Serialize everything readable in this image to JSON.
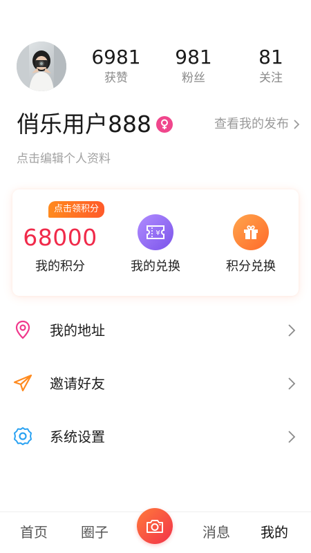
{
  "profile": {
    "username": "俏乐用户888",
    "edit_profile_text": "点击编辑个人资料",
    "view_posts_text": "查看我的发布",
    "stats": [
      {
        "value": "6981",
        "label": "获赞"
      },
      {
        "value": "981",
        "label": "粉丝"
      },
      {
        "value": "81",
        "label": "关注"
      }
    ]
  },
  "points_card": {
    "claim_badge": "点击领积分",
    "points_value": "68000",
    "points_label": "我的积分",
    "redemptions_label": "我的兑换",
    "exchange_label": "积分兑换"
  },
  "menu": [
    {
      "label": "我的地址",
      "icon": "location-pin-icon",
      "color": "#f0388c"
    },
    {
      "label": "邀请好友",
      "icon": "paper-plane-icon",
      "color": "#ff8a1e"
    },
    {
      "label": "系统设置",
      "icon": "gear-icon",
      "color": "#2aa2f2"
    }
  ],
  "tabbar": {
    "home": "首页",
    "circle": "圈子",
    "messages": "消息",
    "mine": "我的",
    "center_icon": "camera-icon"
  },
  "colors": {
    "points_red": "#f02a4a",
    "badge_orange": "#ff7a22",
    "purple": "#8a60f0",
    "orange": "#ff7d30",
    "female_pink": "#f0468c"
  }
}
